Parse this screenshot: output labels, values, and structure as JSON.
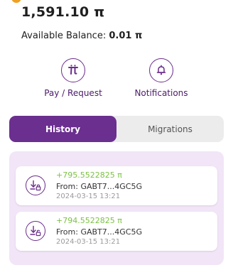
{
  "wallet": {
    "balance": "1,591.10 π",
    "available_label": "Available Balance:",
    "available_value": "0.01 π"
  },
  "actions": [
    {
      "label": "Pay / Request",
      "icon": "pi-icon"
    },
    {
      "label": "Notifications",
      "icon": "bell-icon"
    }
  ],
  "tabs": [
    {
      "label": "History",
      "active": true
    },
    {
      "label": "Migrations",
      "active": false
    }
  ],
  "transactions": [
    {
      "amount": "+795.5522825 π",
      "from": "From: GABT7...4GC5G",
      "date": "2024-03-15 13:21",
      "icon": "receive-locked-icon"
    },
    {
      "amount": "+794.5522825 π",
      "from": "From: GABT7...4GC5G",
      "date": "2024-03-15 13:21",
      "icon": "receive-unlocked-icon"
    }
  ],
  "colors": {
    "brand": "#6b2f8f",
    "amount_positive": "#7cc243",
    "panel_bg": "#f1e5f7"
  }
}
